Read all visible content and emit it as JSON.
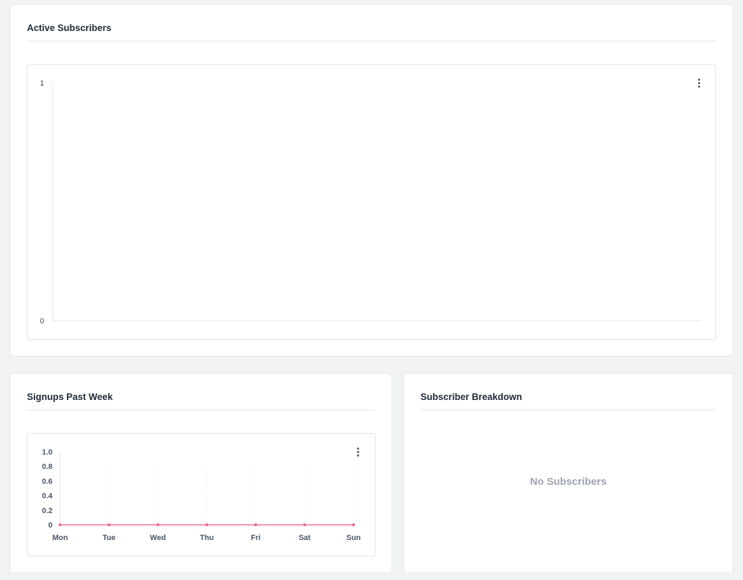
{
  "active_subscribers": {
    "title": "Active Subscribers",
    "menu_icon": "kebab-menu-icon"
  },
  "signups_past_week": {
    "title": "Signups Past Week",
    "menu_icon": "kebab-menu-icon"
  },
  "subscriber_breakdown": {
    "title": "Subscriber Breakdown",
    "empty_message": "No Subscribers"
  },
  "colors": {
    "series_line": "#f48fb1",
    "series_point": "#ec6a9a"
  },
  "chart_data": [
    {
      "type": "line",
      "title": "",
      "xlabel": "",
      "ylabel": "",
      "ylim": [
        0,
        1
      ],
      "y_ticks": [
        "0",
        "1"
      ],
      "series": [],
      "grid": false,
      "legend": "none"
    },
    {
      "type": "line",
      "title": "",
      "xlabel": "",
      "ylabel": "",
      "categories": [
        "Mon",
        "Tue",
        "Wed",
        "Thu",
        "Fri",
        "Sat",
        "Sun"
      ],
      "ylim": [
        0,
        1
      ],
      "y_ticks": [
        "0",
        "0.2",
        "0.4",
        "0.6",
        "0.8",
        "1.0"
      ],
      "series": [
        {
          "values": [
            0,
            0,
            0,
            0,
            0,
            0,
            0
          ]
        }
      ],
      "grid": true,
      "legend": "none"
    }
  ]
}
